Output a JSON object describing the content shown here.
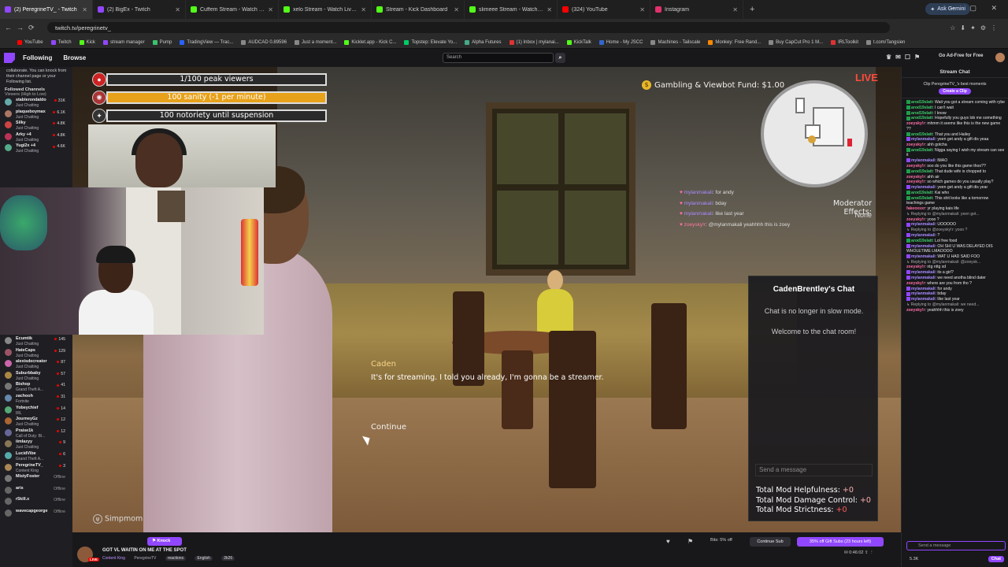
{
  "browser": {
    "tabs": [
      {
        "label": "(2) PeregrineTV_ - Twitch",
        "color": "#9147ff",
        "active": true
      },
      {
        "label": "(2) BigEx - Twitch",
        "color": "#9147ff"
      },
      {
        "label": "Cuffem Stream - Watch Live on",
        "color": "#53fc18"
      },
      {
        "label": "xelo Stream - Watch Live on Ki",
        "color": "#53fc18"
      },
      {
        "label": "Stream - Kick Dashboard",
        "color": "#53fc18"
      },
      {
        "label": "slimeee Stream - Watch Live on",
        "color": "#53fc18"
      },
      {
        "label": "(324) YouTube",
        "color": "#ff0000"
      },
      {
        "label": "Instagram",
        "color": "#e1306c"
      }
    ],
    "new_tab": "+",
    "ask_gemini": "Ask Gemini",
    "url": "twitch.tv/peregrinetv_",
    "bookmarks": [
      {
        "label": "YouTube",
        "color": "#ff0000"
      },
      {
        "label": "Twitch",
        "color": "#9147ff"
      },
      {
        "label": "Kick",
        "color": "#53fc18"
      },
      {
        "label": "stream manager",
        "color": "#9147ff"
      },
      {
        "label": "Pump",
        "color": "#3ac26d"
      },
      {
        "label": "TradingView — Trac...",
        "color": "#2962ff"
      },
      {
        "label": "AUDCAD 0.89596",
        "color": "#888"
      },
      {
        "label": "Just a moment...",
        "color": "#888"
      },
      {
        "label": "Kicklet.app - Kick C...",
        "color": "#53fc18"
      },
      {
        "label": "Topstep: Elevate Yo...",
        "color": "#0c6"
      },
      {
        "label": "Alpha Futures",
        "color": "#4a8"
      },
      {
        "label": "(1) Inbox | mylanai...",
        "color": "#d33"
      },
      {
        "label": "KickTalk",
        "color": "#53fc18"
      },
      {
        "label": "Home - My JSCC",
        "color": "#36c"
      },
      {
        "label": "Machines - Tailscale",
        "color": "#888"
      },
      {
        "label": "Monkey: Free Rand...",
        "color": "#f80"
      },
      {
        "label": "Buy CapCut Pro 1 M...",
        "color": "#888"
      },
      {
        "label": "IRLToolkit",
        "color": "#d33"
      },
      {
        "label": "t.com/Tangsien",
        "color": "#888"
      }
    ]
  },
  "nav": {
    "following": "Following",
    "browse": "Browse",
    "search_placeholder": "Search",
    "ad_free": "Go Ad-Free for Free"
  },
  "sidebar": {
    "note": "collaborate. You can knock from their channel page or your Following list.",
    "followed_heading": "Followed Channels",
    "sort": "Viewers (High to Low)",
    "channels_top": [
      {
        "name": "stablerondaldo",
        "game": "Just Chatting",
        "viewers": "31K",
        "color": "#6aa"
      },
      {
        "name": "plaqueboymax",
        "game": "Just Chatting",
        "viewers": "6.1K",
        "color": "#a76"
      },
      {
        "name": "Silky",
        "game": "Just Chatting",
        "viewers": "4.8K",
        "color": "#c44"
      },
      {
        "name": "Arky +4",
        "game": "Just Chatting",
        "viewers": "4.8K",
        "color": "#b35"
      },
      {
        "name": "Yugi2x +4",
        "game": "Just Chatting",
        "viewers": "4.6K",
        "color": "#5a8"
      }
    ],
    "channels_bottom": [
      {
        "name": "Ecumtik",
        "game": "Just Chatting",
        "viewers": "145",
        "color": "#888"
      },
      {
        "name": "HateCaps",
        "game": "Just Chatting",
        "viewers": "129",
        "color": "#956"
      },
      {
        "name": "alexisdecreator",
        "game": "Just Chatting",
        "viewers": "87",
        "color": "#c6a"
      },
      {
        "name": "Suburbbaby",
        "game": "Just Chatting",
        "viewers": "57",
        "color": "#a84"
      },
      {
        "name": "Bishop",
        "game": "Grand Theft A...",
        "viewers": "41",
        "color": "#777"
      },
      {
        "name": "zachooh",
        "game": "Fortnite",
        "viewers": "31",
        "color": "#68a"
      },
      {
        "name": "Yobeychief",
        "game": "IRL",
        "viewers": "14",
        "color": "#5a7"
      },
      {
        "name": "JourneyGz",
        "game": "Just Chatting",
        "viewers": "12",
        "color": "#a63"
      },
      {
        "name": "Praise1k",
        "game": "Call of Duty: Bl...",
        "viewers": "12",
        "color": "#669"
      },
      {
        "name": "iimlazyy",
        "game": "Just Chatting",
        "viewers": "9",
        "color": "#875"
      },
      {
        "name": "LucidVibe",
        "game": "Grand Theft A...",
        "viewers": "6",
        "color": "#5aa"
      },
      {
        "name": "PeregrineTV_",
        "game": "Content King",
        "viewers": "3",
        "color": "#a85"
      },
      {
        "name": "MistyFoster",
        "game": "",
        "viewers": "Offline",
        "color": "#777"
      },
      {
        "name": "aris",
        "game": "",
        "viewers": "Offline",
        "color": "#666"
      },
      {
        "name": "r5kill.x",
        "game": "",
        "viewers": "Offline",
        "color": "#666"
      },
      {
        "name": "wavecapgeorge",
        "game": "",
        "viewers": "Offline",
        "color": "#666"
      }
    ]
  },
  "game": {
    "peak_viewers": "1/100 peak viewers",
    "sanity": "100 sanity (-1 per minute)",
    "sanity_level": 1.0,
    "notoriety": "100 notoriety until suspension",
    "gamble": "Gambling & Viewbot Fund: $1.00",
    "gamble_coin": "$",
    "live": "LIVE",
    "mod_effects": "Moderator Effects:",
    "mod_none": "None",
    "overlay_chat": [
      {
        "user": "mylanmakali",
        "text": ": for andy"
      },
      {
        "user": "mylanmakali",
        "text": ": bday"
      },
      {
        "user": "mylanmakali",
        "text": ": like last year"
      },
      {
        "user": "zoeysky!r",
        "text": ": @mylanmakali yeahhhh this is zoey"
      }
    ],
    "chat_panel": {
      "title": "CadenBrentley's Chat",
      "line1": "Chat is no longer in slow mode.",
      "line2": "Welcome to the chat room!",
      "placeholder": "Send a message",
      "helpfulness": "Total Mod Helpfulness: ",
      "helpfulness_v": "+0",
      "damage": "Total Mod Damage Control: ",
      "damage_v": "+0",
      "strictness": "Total Mod Strictness: ",
      "strictness_v": "+0"
    },
    "speaker": "Caden",
    "dialogue": "It's for streaming. I told you already, I'm gonna be a streamer.",
    "continue": "Continue",
    "simp": "Simpmom"
  },
  "stream": {
    "title": "GOT VL WAITIN ON ME AT THE SPOT",
    "live_badge": "LIVE",
    "knock": "Knock",
    "category": "Content King",
    "channel": "PeregrineTV",
    "tags": [
      "reactions",
      "English",
      "2k26"
    ],
    "bits": "Bits: 5% off",
    "continue_sub": "Continue Sub",
    "gift_subs": "35% off Gift Subs (23 hours left)",
    "uptime": "0:46:02"
  },
  "chat": {
    "header": "Stream Chat",
    "clip_text": "Clip PeregrineTV_'s best moments",
    "clip_button": "Create a Clip",
    "send_placeholder": "Send a message",
    "chat_button": "Chat",
    "viewers": "5.3K",
    "messages": [
      {
        "user": "arod19slatt",
        "color": "#3ecf6a",
        "text": ": Wait you got a stream coming with rybe",
        "kind": "g"
      },
      {
        "user": "arod19slatt",
        "color": "#3ecf6a",
        "text": ": I can't wait",
        "kind": "g"
      },
      {
        "user": "arod19slatt",
        "color": "#3ecf6a",
        "text": ": I know",
        "kind": "g"
      },
      {
        "user": "arod19slatt",
        "color": "#3ecf6a",
        "text": ": Hopefully you guys lob me something",
        "kind": "g"
      },
      {
        "user": "zoeysky!r",
        "color": "#ff6fa5",
        "text": ": mhmm it seems like this is the new game ??",
        "kind": "n"
      },
      {
        "user": "arod19slatt",
        "color": "#3ecf6a",
        "text": ": That you and Hailey",
        "kind": "g"
      },
      {
        "user": "mylanmakali",
        "color": "#a98bff",
        "text": ": yeen get andy a gift dis yeaa",
        "kind": "p"
      },
      {
        "user": "zoeysky!r",
        "color": "#ff6fa5",
        "text": ": ahh gotcha",
        "kind": "n"
      },
      {
        "user": "arod19slatt",
        "color": "#3ecf6a",
        "text": ": Nigga saying I wish my stream can see it",
        "kind": "g"
      },
      {
        "user": "mylanmakali",
        "color": "#a98bff",
        "text": ": lMAO",
        "kind": "p"
      },
      {
        "user": "zoeysky!r",
        "color": "#ff6fa5",
        "text": ": soo do you like this game thoo??",
        "kind": "n"
      },
      {
        "user": "arod19slatt",
        "color": "#3ecf6a",
        "text": ": That dude wife is chopped to",
        "kind": "g"
      },
      {
        "user": "zoeysky!r",
        "color": "#ff6fa5",
        "text": ": ahh air",
        "kind": "n"
      },
      {
        "user": "zoeysky!r",
        "color": "#ff6fa5",
        "text": ": so which games do you usually play?",
        "kind": "n"
      },
      {
        "user": "mylanmakali",
        "color": "#a98bff",
        "text": ": yeen get andy a gift dis year",
        "kind": "p"
      },
      {
        "user": "arod19slatt",
        "color": "#3ecf6a",
        "text": ": Kai who",
        "kind": "g"
      },
      {
        "user": "arod19slatt",
        "color": "#3ecf6a",
        "text": ": This shit looks like a tomorrow teachings game",
        "kind": "g"
      },
      {
        "user": "fakeoxsxr",
        "color": "#ff6fa5",
        "text": ": yr playing kais life",
        "kind": "n"
      },
      {
        "user": "Replying to @mylanmakali: yeen get...",
        "color": "#aaa",
        "text": "",
        "kind": "r"
      },
      {
        "user": "zoeysky!r",
        "color": "#ff6fa5",
        "text": ": yooo ?",
        "kind": "n"
      },
      {
        "user": "mylanmakali",
        "color": "#a98bff",
        "text": ": UOOOOO",
        "kind": "p"
      },
      {
        "user": "Replying to @zoeysky!r: yooo ?",
        "color": "#aaa",
        "text": "",
        "kind": "r"
      },
      {
        "user": "mylanmakali",
        "color": "#a98bff",
        "text": ": ?",
        "kind": "p"
      },
      {
        "user": "arod19slatt",
        "color": "#3ecf6a",
        "text": ": Lol free food",
        "kind": "g"
      },
      {
        "user": "mylanmakali",
        "color": "#a98bff",
        "text": ": OH SHI U WAS DELAYED DIS WHOLETIME LMAOOOO",
        "kind": "p"
      },
      {
        "user": "mylanmakali",
        "color": "#a98bff",
        "text": ": WAT U HAD SAID FOO",
        "kind": "p"
      },
      {
        "user": "Replying to @mylanmakali: @zoeysk...",
        "color": "#aaa",
        "text": "",
        "kind": "r"
      },
      {
        "user": "zoeysky!r",
        "color": "#ff6fa5",
        "text": ": ntg nttg xd",
        "kind": "n"
      },
      {
        "user": "mylanmakali",
        "color": "#a98bff",
        "text": ": its a girl?",
        "kind": "p"
      },
      {
        "user": "mylanmakali",
        "color": "#a98bff",
        "text": ": we need anotha blind dater",
        "kind": "p"
      },
      {
        "user": "zoeysky!r",
        "color": "#ff6fa5",
        "text": ": where are you from tho ?",
        "kind": "n"
      },
      {
        "user": "mylanmakali",
        "color": "#a98bff",
        "text": ": for andy",
        "kind": "p"
      },
      {
        "user": "mylanmakali",
        "color": "#a98bff",
        "text": ": bday",
        "kind": "p"
      },
      {
        "user": "mylanmakali",
        "color": "#a98bff",
        "text": ": like last year",
        "kind": "p"
      },
      {
        "user": "Replying to @mylanmakali: we need...",
        "color": "#aaa",
        "text": "",
        "kind": "r"
      },
      {
        "user": "zoeysky!r",
        "color": "#ff6fa5",
        "text": ": yeahhhh this is zoey",
        "kind": "n"
      }
    ]
  }
}
